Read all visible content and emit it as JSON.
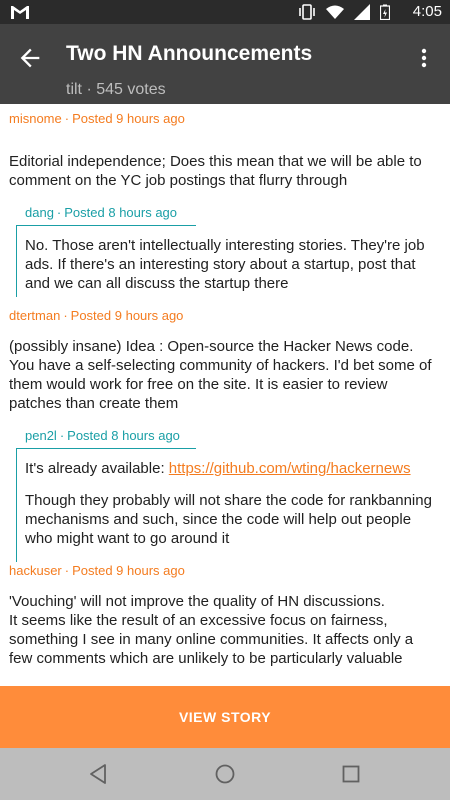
{
  "status_bar": {
    "time": "4:05",
    "icons": [
      "gmail-icon",
      "vibrate-icon",
      "wifi-icon",
      "signal-icon",
      "battery-icon"
    ]
  },
  "app_bar": {
    "title": "Two HN Announcements",
    "subtitle": "tilt · 545 votes"
  },
  "comments": [
    {
      "author": "misnome",
      "posted": "Posted 9 hours ago",
      "paragraphs": [
        "Editorial independence; Does this mean that we will be able to comment on the YC job postings that flurry through"
      ],
      "reply": {
        "author": "dang",
        "posted": "Posted 8 hours ago",
        "paragraphs": [
          "No. Those aren't intellectually interesting stories. They're job ads. If there's an interesting story about a startup, post that and we can all discuss the startup there"
        ]
      }
    },
    {
      "author": "dtertman",
      "posted": "Posted 9 hours ago",
      "paragraphs": [
        "(possibly insane) Idea : Open-source the Hacker News code. You have a self-selecting community of hackers. I'd bet some of them would work for free on the site. It is easier to review patches than create them"
      ],
      "reply": {
        "author": "pen2l",
        "posted": "Posted 8 hours ago",
        "paragraphs_lead": "It's already available: ",
        "link": "https://github.com/wting/hackernews",
        "paragraphs": [
          "Though they probably will not share the code for rankbanning mechanisms and such, since the code will help out people who might want to go around it"
        ]
      }
    },
    {
      "author": "hackuser",
      "posted": "Posted 9 hours ago",
      "paragraphs": [
        "'Vouching' will not improve the quality of HN discussions.",
        "It seems like the result of an excessive focus on fairness, something I see in many online communities. It affects only a few comments which are unlikely to be particularly valuable"
      ]
    }
  ],
  "cta": {
    "label": "VIEW STORY"
  },
  "colors": {
    "accent": "#ff8c3a",
    "reply_accent": "#1a9fa6",
    "app_bar": "#424242",
    "status_bar": "#2b2b2b"
  }
}
